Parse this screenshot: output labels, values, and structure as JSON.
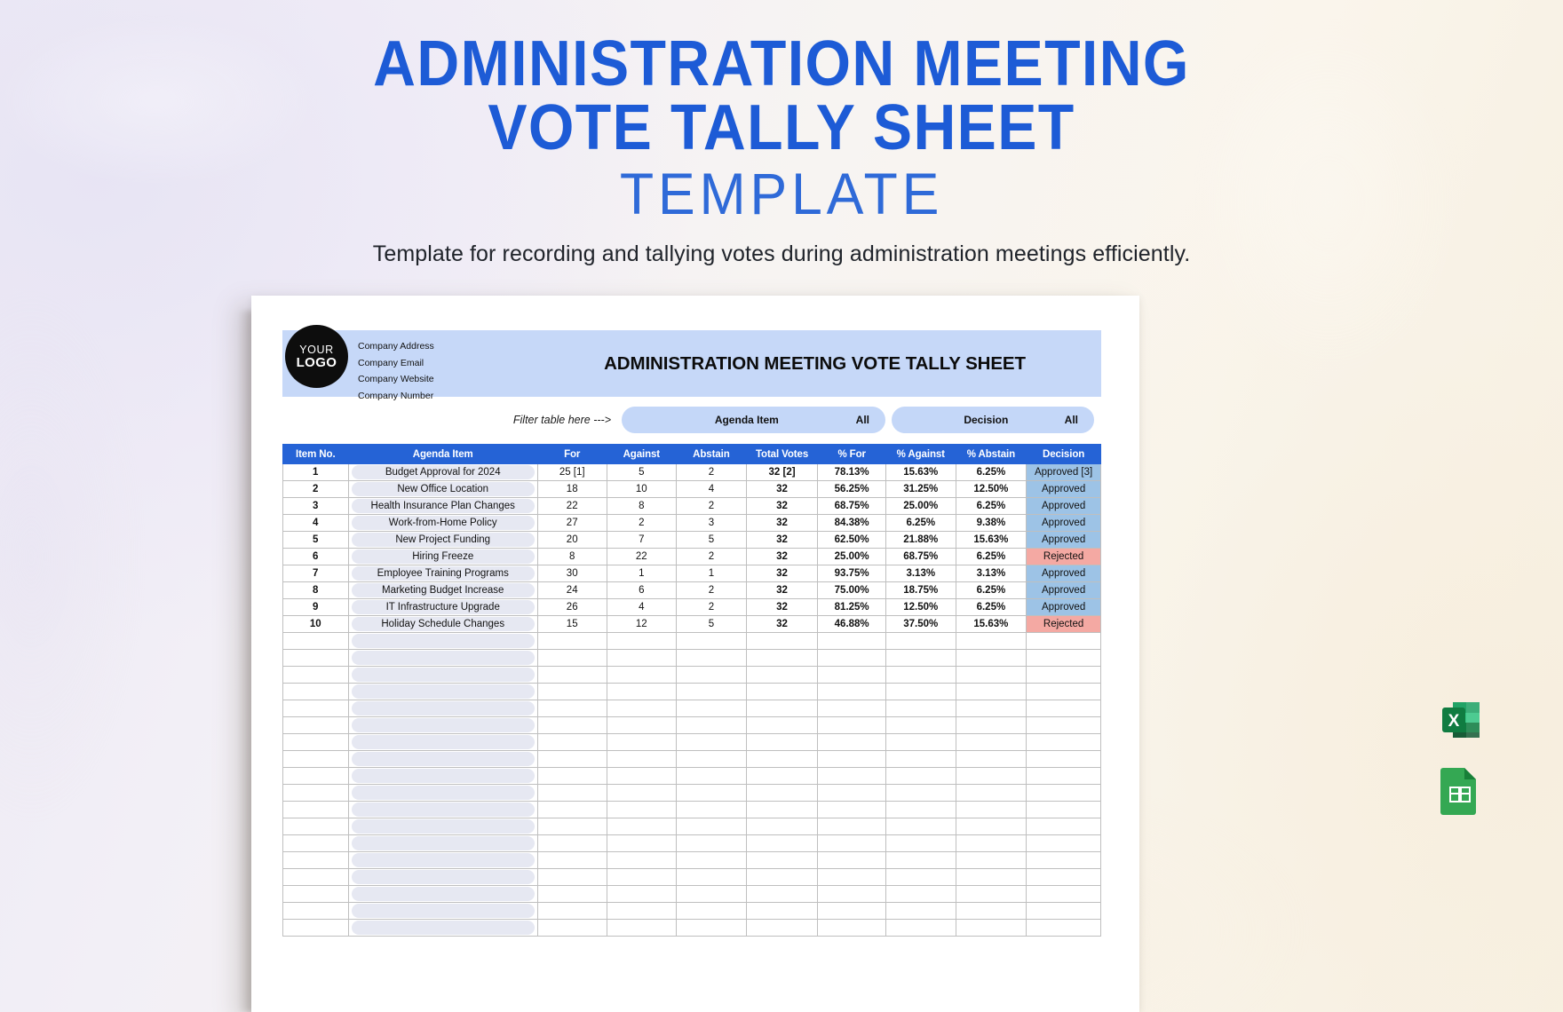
{
  "hero": {
    "title_line1": "ADMINISTRATION MEETING",
    "title_line2": "VOTE TALLY SHEET",
    "title_line3": "TEMPLATE",
    "description": "Template for recording and tallying votes during administration meetings efficiently."
  },
  "document": {
    "logo": {
      "line1": "YOUR",
      "line2": "LOGO"
    },
    "company": [
      "Company Address",
      "Company Email",
      "Company Website",
      "Company Number"
    ],
    "title": "ADMINISTRATION MEETING VOTE TALLY SHEET",
    "filter": {
      "hint": "Filter table here --->",
      "pills": [
        {
          "label": "Agenda Item",
          "value": "All"
        },
        {
          "label": "Decision",
          "value": "All"
        }
      ]
    },
    "table": {
      "columns": [
        "Item No.",
        "Agenda Item",
        "For",
        "Against",
        "Abstain",
        "Total Votes",
        "% For",
        "% Against",
        "% Abstain",
        "Decision"
      ],
      "rows": [
        {
          "item": "1",
          "agenda": "Budget Approval for 2024",
          "for": "25 [1]",
          "against": "5",
          "abstain": "2",
          "total": "32 [2]",
          "pct_for": "78.13%",
          "pct_against": "15.63%",
          "pct_abstain": "6.25%",
          "decision": "Approved [3]",
          "state": "approved"
        },
        {
          "item": "2",
          "agenda": "New Office Location",
          "for": "18",
          "against": "10",
          "abstain": "4",
          "total": "32",
          "pct_for": "56.25%",
          "pct_against": "31.25%",
          "pct_abstain": "12.50%",
          "decision": "Approved",
          "state": "approved"
        },
        {
          "item": "3",
          "agenda": "Health Insurance Plan Changes",
          "for": "22",
          "against": "8",
          "abstain": "2",
          "total": "32",
          "pct_for": "68.75%",
          "pct_against": "25.00%",
          "pct_abstain": "6.25%",
          "decision": "Approved",
          "state": "approved"
        },
        {
          "item": "4",
          "agenda": "Work-from-Home Policy",
          "for": "27",
          "against": "2",
          "abstain": "3",
          "total": "32",
          "pct_for": "84.38%",
          "pct_against": "6.25%",
          "pct_abstain": "9.38%",
          "decision": "Approved",
          "state": "approved"
        },
        {
          "item": "5",
          "agenda": "New Project Funding",
          "for": "20",
          "against": "7",
          "abstain": "5",
          "total": "32",
          "pct_for": "62.50%",
          "pct_against": "21.88%",
          "pct_abstain": "15.63%",
          "decision": "Approved",
          "state": "approved"
        },
        {
          "item": "6",
          "agenda": "Hiring Freeze",
          "for": "8",
          "against": "22",
          "abstain": "2",
          "total": "32",
          "pct_for": "25.00%",
          "pct_against": "68.75%",
          "pct_abstain": "6.25%",
          "decision": "Rejected",
          "state": "rejected"
        },
        {
          "item": "7",
          "agenda": "Employee Training Programs",
          "for": "30",
          "against": "1",
          "abstain": "1",
          "total": "32",
          "pct_for": "93.75%",
          "pct_against": "3.13%",
          "pct_abstain": "3.13%",
          "decision": "Approved",
          "state": "approved"
        },
        {
          "item": "8",
          "agenda": "Marketing Budget Increase",
          "for": "24",
          "against": "6",
          "abstain": "2",
          "total": "32",
          "pct_for": "75.00%",
          "pct_against": "18.75%",
          "pct_abstain": "6.25%",
          "decision": "Approved",
          "state": "approved"
        },
        {
          "item": "9",
          "agenda": "IT Infrastructure Upgrade",
          "for": "26",
          "against": "4",
          "abstain": "2",
          "total": "32",
          "pct_for": "81.25%",
          "pct_against": "12.50%",
          "pct_abstain": "6.25%",
          "decision": "Approved",
          "state": "approved"
        },
        {
          "item": "10",
          "agenda": "Holiday Schedule Changes",
          "for": "15",
          "against": "12",
          "abstain": "5",
          "total": "32",
          "pct_for": "46.88%",
          "pct_against": "37.50%",
          "pct_abstain": "15.63%",
          "decision": "Rejected",
          "state": "rejected"
        }
      ],
      "empty_row_count": 18
    }
  },
  "file_formats": [
    {
      "name": "excel-icon",
      "label": "X"
    },
    {
      "name": "google-sheets-icon",
      "label": ""
    }
  ],
  "colors": {
    "accent_blue": "#2563d6",
    "header_band": "#c6d8f8",
    "approved": "#9dc3e6",
    "rejected": "#f4a9a3",
    "calc_fill": "#d9d9d9"
  }
}
